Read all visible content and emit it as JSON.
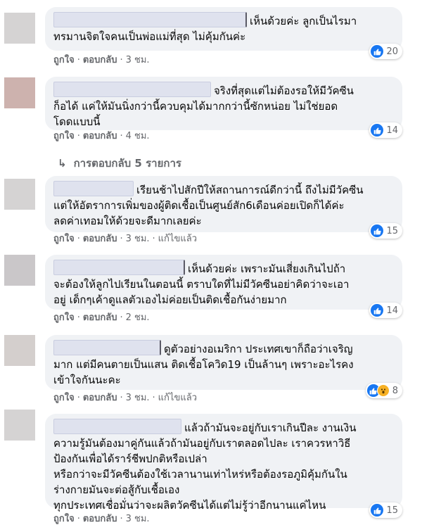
{
  "comments": [
    {
      "lines": [
        "เห็นด้วยค่ะ ลูกเป็นไรมา",
        "ทรมานจิตใจคนเป็นพ่อแม่ที่สุด ไม่คุ้มกันค่ะ"
      ],
      "reactions": {
        "types": [
          "like"
        ],
        "count": "20"
      },
      "actions": {
        "like": "ถูกใจ",
        "reply": "ตอบกลับ",
        "time": "3 ชม."
      }
    },
    {
      "lines": [
        "จริงที่สุดแต่ไม่ต้องรอให้มีวัคซีน",
        "ก็อได้ แค่ให้มันนิ่งกว่านี้ควบคุมได้มากกว่านี้ซักหน่อย ไม่ใช่ยอด",
        "โดดแบบนี้"
      ],
      "reactions": {
        "types": [
          "like"
        ],
        "count": "14"
      },
      "actions": {
        "like": "ถูกใจ",
        "reply": "ตอบกลับ",
        "time": "4 ชม."
      }
    },
    {
      "lines": [
        "เรียนช้าไปสักปีให้สถานการณ์ดีกว่านี้ ถึงไม่มีวัคซีน",
        "แต่ให้อัตราการเพิ่มของผู้ติดเชื้อเป็นศูนย์สัก6เดือนค่อยเปิดก็ได้ค่ะ",
        "ลดค่าเทอมให้ด้วยจะดีมากเลยค่ะ"
      ],
      "reactions": {
        "types": [
          "like"
        ],
        "count": "15"
      },
      "actions": {
        "like": "ถูกใจ",
        "reply": "ตอบกลับ",
        "time": "3 ชม.",
        "edited": "แก้ไขแล้ว"
      }
    },
    {
      "lines": [
        "เห็นด้วยค่ะ เพราะมันเสี่ยงเกินไปถ้า",
        "จะต้องให้ลูกไปเรียนในตอนนี้ ตราบใดที่ไม่มีวัคซีนอย่าคิดว่าจะเอา",
        "อยู่ เด็กๆเค้าดูแลตัวเองไม่ค่อยเป็นติดเชื้อกันง่ายมาก"
      ],
      "reactions": {
        "types": [
          "like"
        ],
        "count": "14"
      },
      "actions": {
        "like": "ถูกใจ",
        "reply": "ตอบกลับ",
        "time": "2 ชม."
      }
    },
    {
      "lines": [
        "ดูตัวอย่างอเมริกา ประเทศเขาก็ถือว่าเจริญ",
        "มาก แต่มีคนตายเป็นแสน ติดเชื้อโควิด19 เป็นล้านๆ เพราะอะไรคง",
        "เข้าใจกันนะคะ"
      ],
      "reactions": {
        "types": [
          "like",
          "wow"
        ],
        "count": "8"
      },
      "actions": {
        "like": "ถูกใจ",
        "reply": "ตอบกลับ",
        "time": "3 ชม.",
        "edited": "แก้ไขแล้ว"
      }
    },
    {
      "lines": [
        "แล้วถ้ามันจะอยู่กับเราเกินปีละ งานเงิน",
        "ความรู้มันต้องมาคู่กันแล้วถ้ามันอยู่กับเราตลอดไปละ เราควรหาวิธี",
        "ป้องกันเพื่อได้ราร์ชีพปกติหรือเปล่า",
        "หรือกว่าจะมีวัคซีนต้องใช้เวลานานเท่าไหร่หรือต้องรอภูมิคุ้มกันใน",
        "ร่างกายมันจะต่อสู้กับเชื้อเอง",
        "ทุกประเทศเชื่อมั่นว่าจะผลิตวัคซีนได้แต่ไม่รู้ว่าอีกนานแค่ไหน"
      ],
      "reactions": {
        "types": [
          "like"
        ],
        "count": "15"
      },
      "actions": {
        "like": "ถูกใจ",
        "reply": "ตอบกลับ",
        "time": "3 ชม."
      }
    }
  ],
  "replies_link": {
    "label": "การตอบกลับ 5 รายการ"
  },
  "colors": {
    "bubble": "#f0f2f5",
    "like": "#1877f2",
    "wow": "#f7b125",
    "meta": "#65676b"
  }
}
